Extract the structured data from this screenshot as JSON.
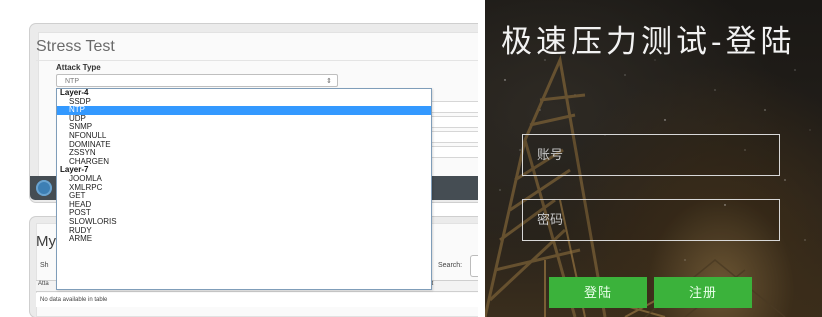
{
  "stress_test": {
    "title": "Stress Test",
    "attack_type_label": "Attack Type",
    "selected_value": "NTP",
    "dropdown": {
      "groups": [
        {
          "label": "Layer-4",
          "options": [
            "SSDP",
            "NTP",
            "UDP",
            "SNMP",
            "NFONULL",
            "DOMINATE",
            "ZSSYN",
            "CHARGEN"
          ]
        },
        {
          "label": "Layer-7",
          "options": [
            "JOOMLA",
            "XMLRPC",
            "GET",
            "HEAD",
            "POST",
            "SLOWLORIS",
            "RUDY",
            "ARME"
          ]
        }
      ],
      "selected": "NTP"
    }
  },
  "my_section": {
    "title": "My",
    "show_label": "Sh",
    "search_label": "Search:",
    "table_header_left": "Atta",
    "table_header_right": "ft",
    "empty_text": "No data available in table"
  },
  "login": {
    "title": "极速压力测试-登陆",
    "account_placeholder": "账号",
    "password_placeholder": "密码",
    "login_button": "登陆",
    "register_button": "注册",
    "button_color": "#3bb23b"
  }
}
